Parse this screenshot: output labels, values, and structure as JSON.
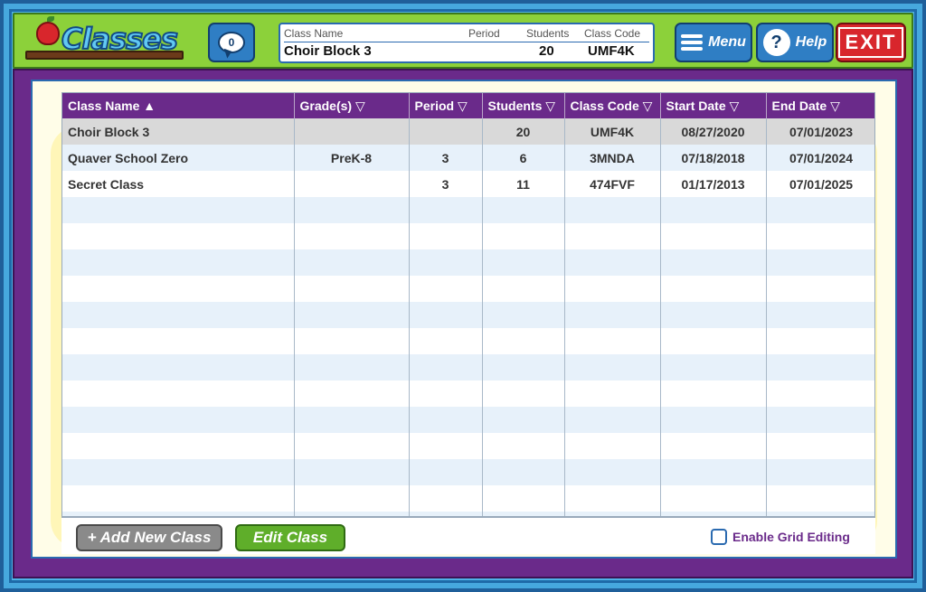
{
  "header": {
    "logo_text": "Classes",
    "chat_count": "0",
    "menu_label": "Menu",
    "help_label": "Help",
    "exit_label": "EXIT"
  },
  "info": {
    "labels": {
      "class_name": "Class Name",
      "period": "Period",
      "students": "Students",
      "class_code": "Class Code"
    },
    "values": {
      "class_name": "Choir Block 3",
      "period": "",
      "students": "20",
      "class_code": "UMF4K"
    }
  },
  "table": {
    "columns": [
      "Class Name ▲",
      "Grade(s) ▽",
      "Period ▽",
      "Students ▽",
      "Class Code ▽",
      "Start Date ▽",
      "End Date ▽"
    ],
    "rows": [
      {
        "name": "Choir Block 3",
        "grades": "",
        "period": "",
        "students": "20",
        "code": "UMF4K",
        "start": "08/27/2020",
        "end": "07/01/2023"
      },
      {
        "name": "Quaver School Zero",
        "grades": "PreK-8",
        "period": "3",
        "students": "6",
        "code": "3MNDA",
        "start": "07/18/2018",
        "end": "07/01/2024"
      },
      {
        "name": "Secret Class",
        "grades": "",
        "period": "3",
        "students": "11",
        "code": "474FVF",
        "start": "01/17/2013",
        "end": "07/01/2025"
      }
    ]
  },
  "footer": {
    "add_label": "+ Add New Class",
    "edit_label": "Edit Class",
    "grid_editing_label": "Enable Grid Editing"
  }
}
